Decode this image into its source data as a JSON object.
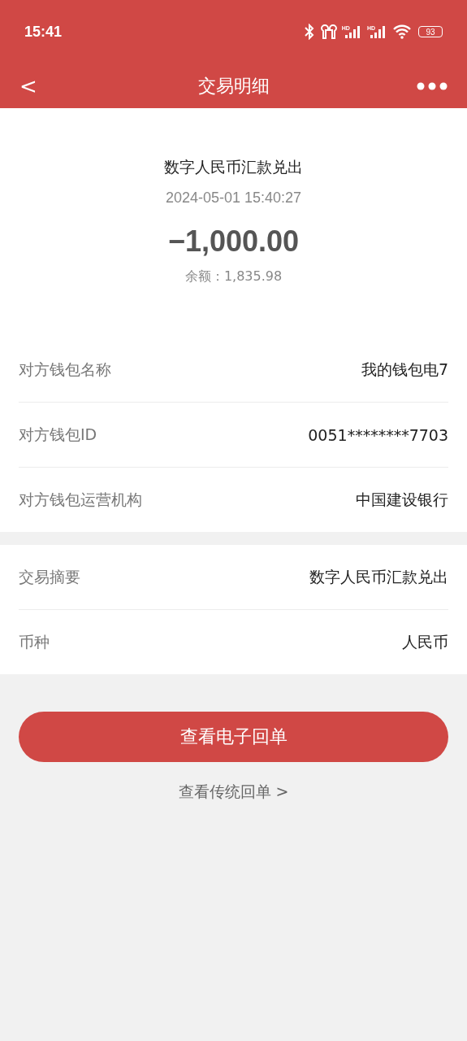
{
  "status_bar": {
    "time": "15:41",
    "network_labels": [
      "HD",
      "HD"
    ],
    "battery": "93"
  },
  "nav": {
    "back": "<",
    "title": "交易明细"
  },
  "summary": {
    "title": "数字人民币汇款兑出",
    "datetime": "2024-05-01 15:40:27",
    "amount": "−1,000.00",
    "balance": "余额：1,835.98"
  },
  "sections": [
    {
      "rows": [
        {
          "label": "对方钱包名称",
          "value": "我的钱包电7"
        },
        {
          "label": "对方钱包ID",
          "value": "0051********7703"
        },
        {
          "label": "对方钱包运营机构",
          "value": "中国建设银行"
        }
      ]
    },
    {
      "rows": [
        {
          "label": "交易摘要",
          "value": "数字人民币汇款兑出"
        },
        {
          "label": "币种",
          "value": "人民币"
        }
      ]
    }
  ],
  "primary_button": "查看电子回单",
  "secondary_link": "查看传统回单 >"
}
